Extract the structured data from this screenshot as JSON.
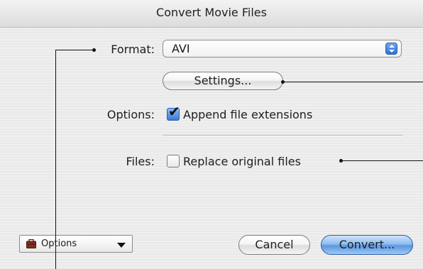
{
  "window": {
    "title": "Convert Movie Files"
  },
  "form": {
    "format_label": "Format:",
    "format_value": "AVI",
    "settings_label": "Settings...",
    "options_label": "Options:",
    "append_label": "Append file extensions",
    "append_checked": true,
    "files_label": "Files:",
    "replace_label": "Replace original files",
    "replace_checked": false
  },
  "footer": {
    "options_menu_label": "Options",
    "cancel_label": "Cancel",
    "convert_label": "Convert..."
  },
  "icons": [
    "popup-arrows-icon",
    "checkmark-icon",
    "briefcase-icon",
    "chevron-down-icon"
  ],
  "colors": {
    "accent": "#3d7ad8",
    "default_button": "#5b97e0"
  }
}
